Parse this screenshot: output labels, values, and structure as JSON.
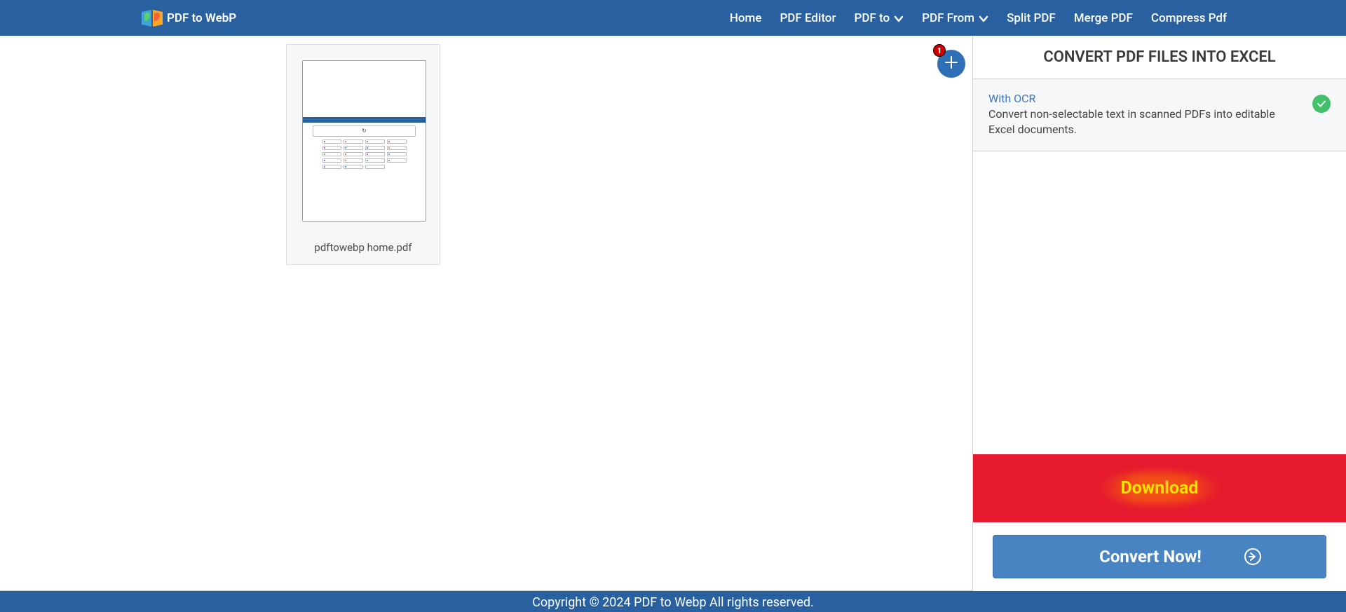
{
  "header": {
    "logo_text": "PDF to WebP",
    "nav": [
      "Home",
      "PDF Editor",
      "PDF to",
      "PDF From",
      "Split PDF",
      "Merge PDF",
      "Compress Pdf"
    ]
  },
  "file": {
    "name": "pdftowebp home.pdf"
  },
  "add_button": {
    "badge_count": "1"
  },
  "sidebar": {
    "title": "CONVERT PDF FILES INTO EXCEL",
    "ocr_label": "With OCR",
    "ocr_description": "Convert non-selectable text in scanned PDFs into editable Excel documents.",
    "download_label": "Download",
    "convert_label": "Convert Now!"
  },
  "footer": {
    "text": "Copyright © 2024 PDF to Webp All rights reserved."
  }
}
